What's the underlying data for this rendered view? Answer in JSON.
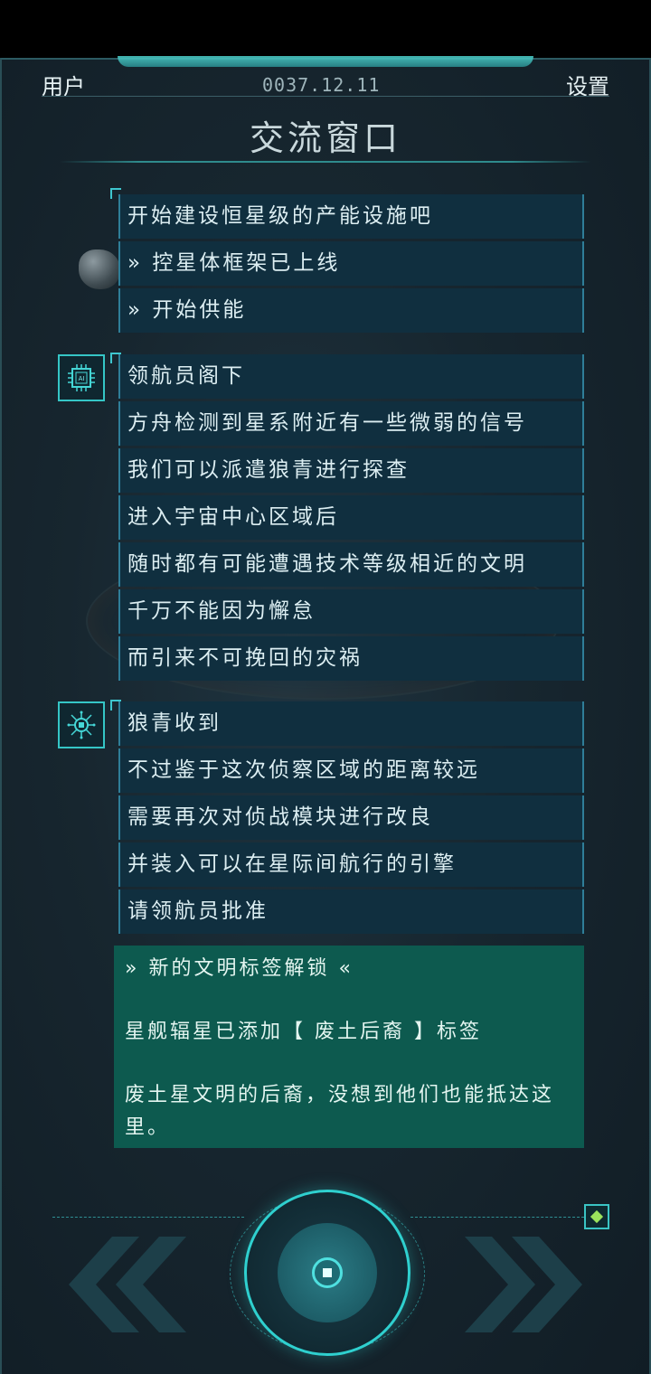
{
  "header": {
    "user_label": "用户",
    "date": "0037.12.11",
    "settings_label": "设置",
    "title": "交流窗口"
  },
  "group1": {
    "messages": [
      "开始建设恒星级的产能设施吧",
      "» 控星体框架已上线",
      "» 开始供能"
    ]
  },
  "group2": {
    "avatar_icon": "ai-chip-icon",
    "avatar_text": "AI",
    "messages": [
      "领航员阁下",
      "方舟检测到星系附近有一些微弱的信号",
      "我们可以派遣狼青进行探查",
      "进入宇宙中心区域后",
      "随时都有可能遭遇技术等级相近的文明",
      "千万不能因为懈怠",
      "而引来不可挽回的灾祸"
    ]
  },
  "group3": {
    "avatar_icon": "circuit-chip-icon",
    "messages": [
      "狼青收到",
      "不过鉴于这次侦察区域的距离较远",
      "需要再次对侦战模块进行改良",
      "并装入可以在星际间航行的引擎",
      "请领航员批准"
    ]
  },
  "notice": {
    "heading": "» 新的文明标签解锁 «",
    "line1": "星舰辐星已添加【 废土后裔 】标签",
    "line2": "废土星文明的后裔，没想到他们也能抵达这里。"
  },
  "controls": {
    "prev_icon": "double-chevron-left-icon",
    "next_icon": "double-chevron-right-icon",
    "main_icon": "stop-square-icon",
    "gem_icon": "diamond-icon"
  },
  "colors": {
    "accent": "#2fd0cf",
    "bubble": "#102f3f",
    "notice": "#0d5a4f"
  }
}
